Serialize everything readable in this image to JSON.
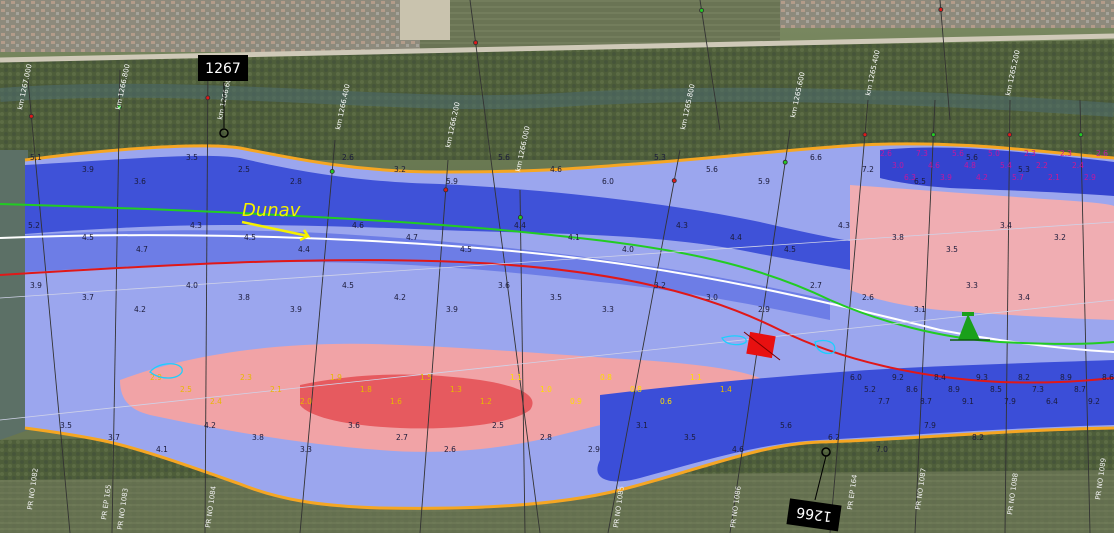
{
  "map": {
    "river_name": "Dunav",
    "river_km_markers": [
      {
        "id": "1267",
        "label": "1267"
      },
      {
        "id": "1266",
        "label": "1266"
      }
    ],
    "km_lines": [
      "km 1267.000",
      "km 1266.800",
      "km 1266.600",
      "km 1266.400",
      "km 1266.200",
      "km 1266.000",
      "km 1265.800",
      "km 1265.600",
      "km 1265.400",
      "km 1265.200"
    ],
    "profiles": [
      "PR NO 1082",
      "PR EP 165",
      "PR NO 1083",
      "PR NO 1084",
      "PR NO 1085",
      "PR NO 1086",
      "PR EP 164",
      "PR NO 1087",
      "PR NO 1088",
      "PR NO 1089"
    ],
    "colors": {
      "deep": "#3c4fd6",
      "medium": "#9aa6f0",
      "shallow": "#f2a3a6",
      "very_shallow": "#e8434c",
      "sailing_line_green": "#22cc22",
      "sailing_line_red": "#e01818",
      "sailing_line_white": "#ffffff",
      "bank": "#f5a623",
      "buoy_red": "#e81010",
      "buoy_green": "#1aa01a"
    },
    "depth_values": {
      "deep_row_upper": [
        "5.1",
        "3.9",
        "3.6",
        "3.5",
        "2.5",
        "2.8",
        "2.6",
        "3.2",
        "5.9",
        "5.6",
        "4.6",
        "6.0",
        "5.3",
        "5.6",
        "5.9",
        "6.6",
        "7.2",
        "6.5",
        "5.6",
        "5.3"
      ],
      "deep_row_mid": [
        "5.2",
        "4.5",
        "4.7",
        "4.3",
        "4.5",
        "4.4",
        "4.6",
        "4.7",
        "4.5",
        "4.4",
        "4.1",
        "4.0",
        "4.3",
        "4.4",
        "4.5",
        "4.3",
        "3.8",
        "3.5",
        "3.4",
        "3.2"
      ],
      "medium_row": [
        "3.9",
        "3.7",
        "4.2",
        "4.0",
        "3.8",
        "3.9",
        "4.5",
        "4.2",
        "3.9",
        "3.6",
        "3.5",
        "3.3",
        "3.2",
        "3.0",
        "2.9",
        "2.7",
        "2.6",
        "3.1",
        "3.3",
        "3.4"
      ],
      "shallow_row": [
        "2.9",
        "2.5",
        "2.4",
        "2.3",
        "2.1",
        "2.0",
        "1.9",
        "1.8",
        "1.6",
        "1.5",
        "1.3",
        "1.2",
        "1.1",
        "1.0",
        "0.9",
        "0.8",
        "0.8",
        "0.6",
        "1.1",
        "1.4"
      ],
      "lower_row": [
        "3.5",
        "3.7",
        "4.1",
        "4.2",
        "3.8",
        "3.3",
        "3.6",
        "2.7",
        "2.6",
        "2.5",
        "2.8",
        "2.9",
        "3.1",
        "3.5",
        "4.6",
        "5.6",
        "6.2",
        "7.0",
        "7.9",
        "8.2"
      ],
      "right_deep_row": [
        "6.0",
        "5.2",
        "7.7",
        "9.2",
        "8.6",
        "8.7",
        "8.4",
        "8.9",
        "9.1",
        "9.3",
        "8.5",
        "7.9",
        "8.2",
        "7.3",
        "6.4",
        "8.9",
        "8.7",
        "9.2",
        "8.6",
        "9.3"
      ],
      "right_upper_row": [
        "2.6",
        "3.0",
        "6.3",
        "7.3",
        "4.6",
        "3.9",
        "5.6",
        "4.8",
        "4.2",
        "5.0",
        "5.4",
        "5.7",
        "2.3",
        "2.2",
        "2.1",
        "2.3",
        "2.4",
        "2.9",
        "2.6",
        "2.1"
      ]
    }
  }
}
